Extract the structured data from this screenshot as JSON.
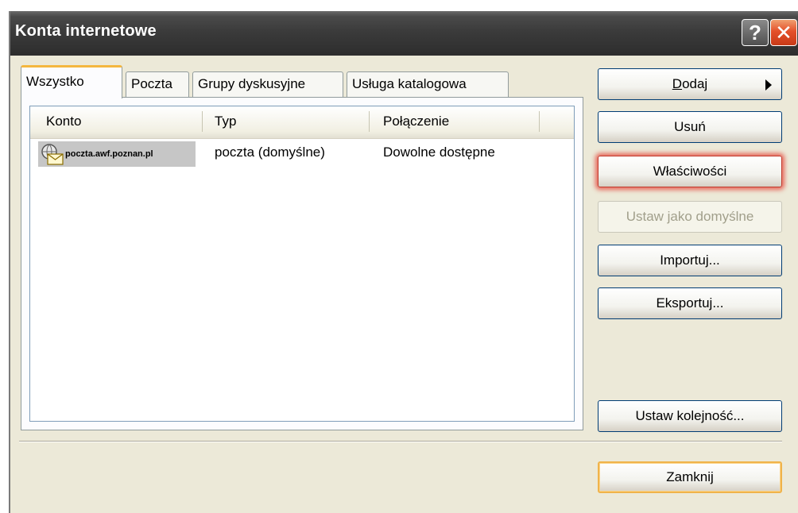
{
  "window": {
    "title": "Konta internetowe",
    "help_label": "?",
    "close_label": "✕"
  },
  "tabs": [
    {
      "label": "Wszystko",
      "active": true
    },
    {
      "label": "Poczta"
    },
    {
      "label": "Grupy dyskusyjne"
    },
    {
      "label": "Usługa katalogowa"
    }
  ],
  "list": {
    "columns": [
      "Konto",
      "Typ",
      "Połączenie"
    ],
    "rows": [
      {
        "account": "poczta.awf.poznan.pl",
        "type": "poczta (domyślne)",
        "connection": "Dowolne dostępne",
        "icon": "mail-account-icon"
      }
    ]
  },
  "buttons": {
    "add": {
      "prefix": "D",
      "rest": "odaj"
    },
    "remove": "Usuń",
    "properties": "Właściwości",
    "set_default": "Ustaw jako domyślne",
    "import": "Importuj...",
    "export": "Eksportuj...",
    "set_order": "Ustaw kolejność...",
    "close": "Zamknij"
  },
  "colors": {
    "titlebar": "#3b3b3b",
    "close_button": "#e4502a",
    "active_tab_accent": "#f4b73f",
    "highlight_glow": "#e63c32"
  }
}
